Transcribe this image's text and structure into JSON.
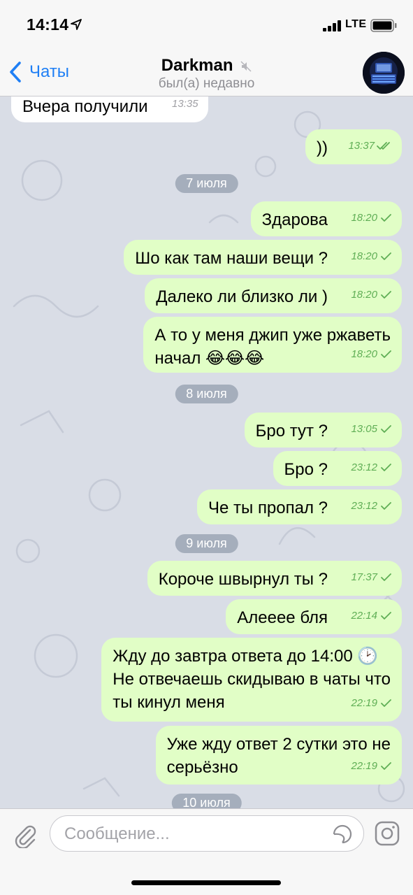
{
  "status_bar": {
    "time": "14:14",
    "network": "LTE"
  },
  "nav": {
    "back_label": "Чаты",
    "title": "Darkman",
    "subtitle": "был(а) недавно"
  },
  "messages": [
    {
      "type": "in",
      "text": "Вчера получили",
      "time": "13:35"
    },
    {
      "type": "out",
      "text": "))",
      "time": "13:37",
      "status": "read"
    },
    {
      "type": "date",
      "text": "7 июля"
    },
    {
      "type": "out",
      "text": "Здарова",
      "time": "18:20",
      "status": "delivered"
    },
    {
      "type": "out",
      "text": "Шо как там наши вещи ?",
      "time": "18:20",
      "status": "delivered"
    },
    {
      "type": "out",
      "text": "Далеко ли близко ли )",
      "time": "18:20",
      "status": "delivered"
    },
    {
      "type": "out",
      "text": "А то у меня джип уже ржаветь",
      "text2": "начал 😂😂😂",
      "time": "18:20",
      "status": "delivered"
    },
    {
      "type": "date",
      "text": "8 июля"
    },
    {
      "type": "out",
      "text": "Бро тут ?",
      "time": "13:05",
      "status": "delivered"
    },
    {
      "type": "out",
      "text": "Бро ?",
      "time": "23:12",
      "status": "delivered"
    },
    {
      "type": "out",
      "text": "Че ты пропал ?",
      "time": "23:12",
      "status": "delivered"
    },
    {
      "type": "date",
      "text": "9 июля"
    },
    {
      "type": "out",
      "text": "Короче швырнул ты ?",
      "time": "17:37",
      "status": "delivered"
    },
    {
      "type": "out",
      "text": "Алееее бля",
      "time": "22:14",
      "status": "delivered"
    },
    {
      "type": "out",
      "text": "Жду до завтра ответа до 14:00 🕑",
      "text2": "Не отвечаешь скидываю в чаты  что",
      "text3": "ты кинул меня",
      "time": "22:19",
      "status": "delivered"
    },
    {
      "type": "out",
      "text": "Уже жду ответ 2 сутки это не",
      "text2": "серьёзно",
      "time": "22:19",
      "status": "delivered"
    },
    {
      "type": "date",
      "text": "10 июля"
    }
  ],
  "input": {
    "placeholder": "Сообщение..."
  },
  "icons": {
    "location": "location-arrow-icon",
    "signal": "signal-icon",
    "battery": "battery-icon",
    "back": "chevron-left-icon",
    "mute": "mute-icon",
    "attach": "paperclip-icon",
    "sticker": "sticker-icon",
    "camera": "camera-icon",
    "tick": "checkmark-icon"
  },
  "colors": {
    "accent": "#1f7ff5",
    "outgoing_bubble": "#e1fec6",
    "incoming_bubble": "#ffffff",
    "status_tick": "#5fae55",
    "chat_background": "#d9dde6"
  }
}
